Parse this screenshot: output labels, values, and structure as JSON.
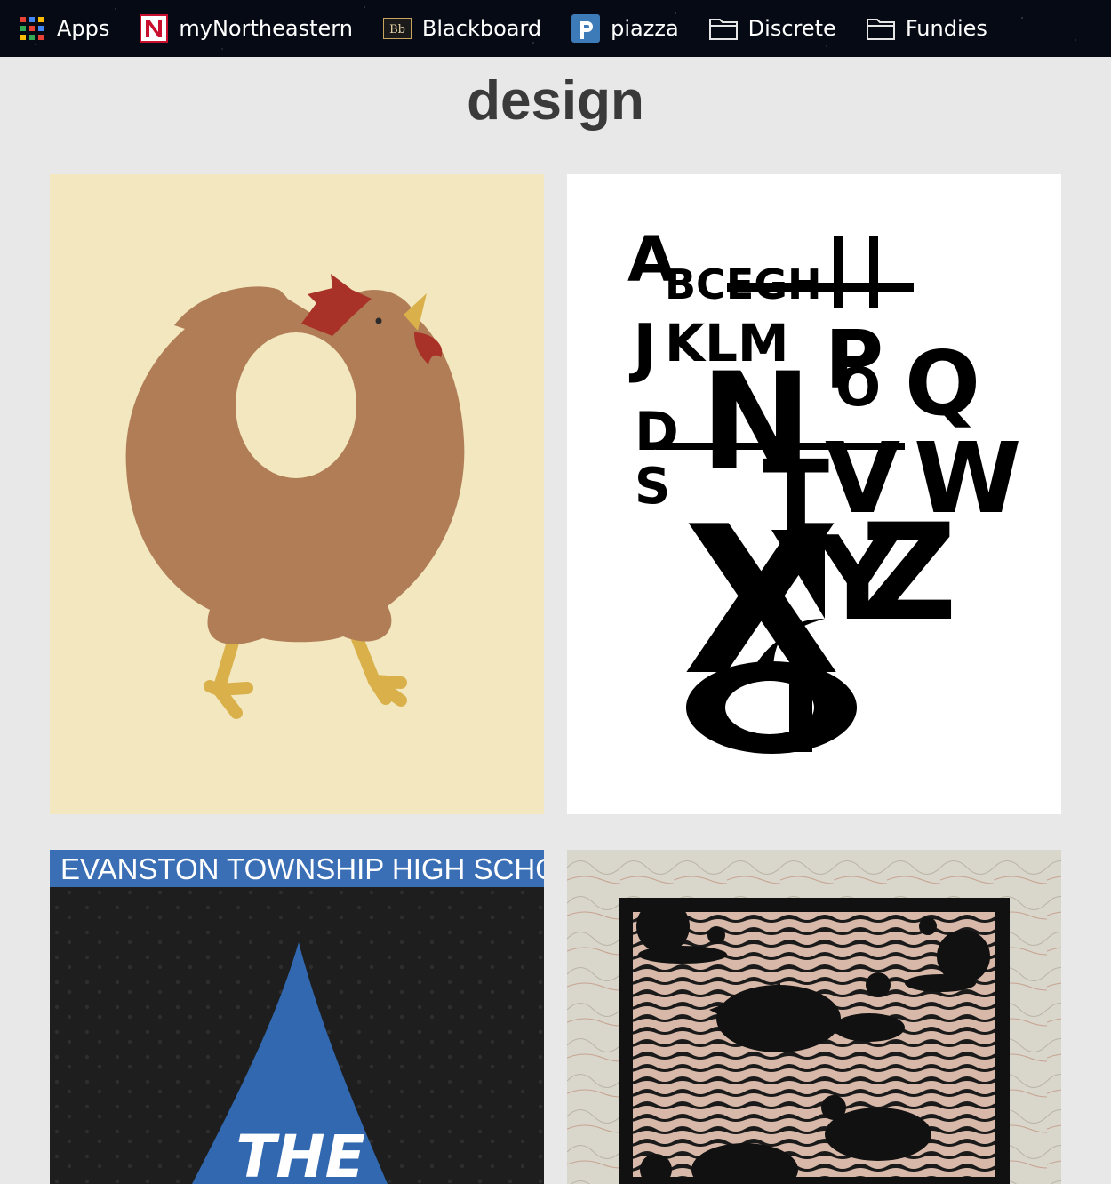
{
  "bookmarks": [
    {
      "label": "Apps",
      "icon": "apps-grid-icon"
    },
    {
      "label": "myNortheastern",
      "icon": "northeastern-logo-icon"
    },
    {
      "label": "Blackboard",
      "icon": "blackboard-logo-icon"
    },
    {
      "label": "piazza",
      "icon": "piazza-logo-icon"
    },
    {
      "label": "Discrete",
      "icon": "folder-icon"
    },
    {
      "label": "Fundies",
      "icon": "folder-icon"
    }
  ],
  "page": {
    "title": "design"
  },
  "gallery": {
    "tiles": [
      {
        "name": "chicken-illustration",
        "background": "#f2e7bf"
      },
      {
        "name": "alphabet-typography-poster",
        "background": "#ffffff"
      },
      {
        "name": "eths-poster",
        "background": "#1e1e1e",
        "banner_text": "EVANSTON TOWNSHIP HIGH SCHOOL",
        "headline": "THE",
        "banner_color": "#3a6fb6"
      },
      {
        "name": "snail-linocut-print",
        "background": "#d7d3c8"
      }
    ]
  },
  "colors": {
    "chicken_body": "#b07d56",
    "comb_red": "#a83228",
    "beak_yellow": "#d9b04a",
    "blue_accent": "#3268b0"
  }
}
